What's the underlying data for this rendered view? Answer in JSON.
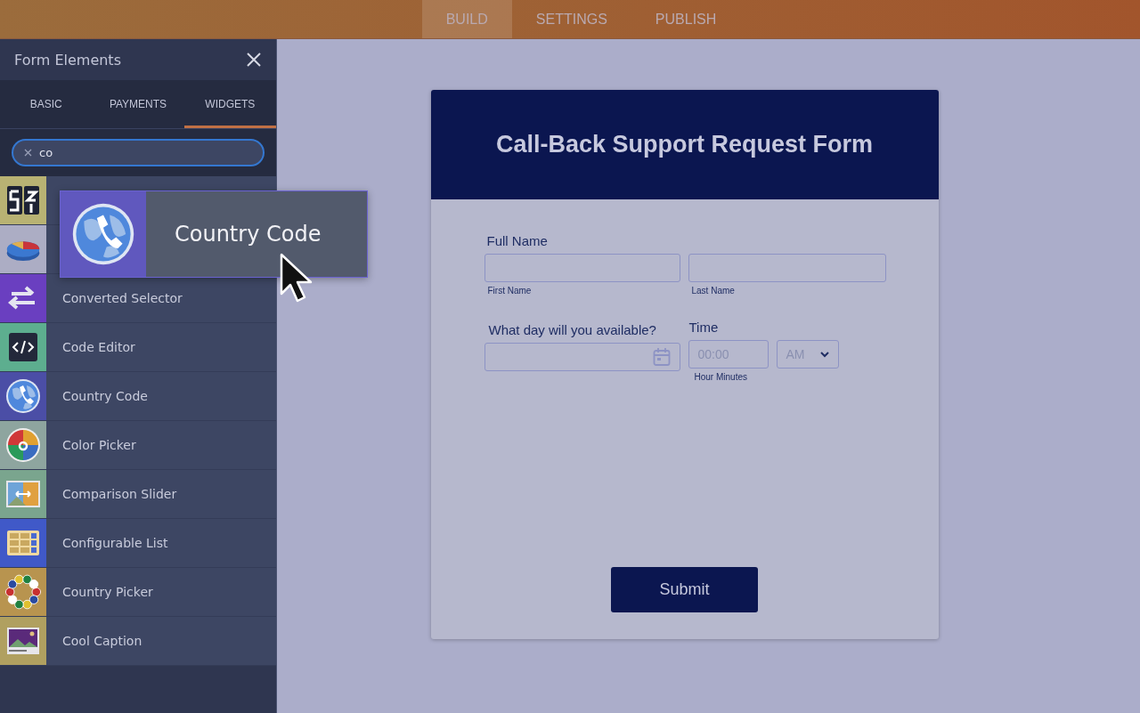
{
  "top_nav": [
    {
      "label": "BUILD",
      "selected": true
    },
    {
      "label": "SETTINGS",
      "selected": false
    },
    {
      "label": "PUBLISH",
      "selected": false
    }
  ],
  "panel": {
    "title": "Form Elements",
    "tabs": [
      {
        "label": "BASIC",
        "selected": false
      },
      {
        "label": "PAYMENTS",
        "selected": false
      },
      {
        "label": "WIDGETS",
        "selected": true
      }
    ],
    "search": {
      "value": "co"
    },
    "items": [
      {
        "kind": "counter",
        "color": "#b8b273"
      },
      {
        "kind": "pie",
        "color": "#acadc4"
      },
      {
        "kind": "arrows",
        "color": "#6a3fc0",
        "label": "Converted Selector"
      },
      {
        "kind": "code",
        "color": "#5dae8f",
        "label": "Code Editor"
      },
      {
        "kind": "globe",
        "color": "#4b4ea6",
        "label": "Country Code"
      },
      {
        "kind": "wheel",
        "color": "#8ea59f",
        "label": "Color Picker"
      },
      {
        "kind": "compare",
        "color": "#7aa58e",
        "label": "Comparison Slider"
      },
      {
        "kind": "list",
        "color": "#4059c8",
        "label": "Configurable List"
      },
      {
        "kind": "flags",
        "color": "#b8944f",
        "label": "Country Picker"
      },
      {
        "kind": "caption",
        "color": "#b0a060",
        "label": "Cool Caption"
      }
    ]
  },
  "drag_card": {
    "kind": "globe",
    "label": "Country Code"
  },
  "form": {
    "title": "Call-Back Support Request Form",
    "full_name": {
      "label": "Full Name",
      "first_sublabel": "First Name",
      "last_sublabel": "Last Name"
    },
    "date": {
      "label": "What day will you available?"
    },
    "time": {
      "label": "Time",
      "placeholder": "00:00",
      "sublabel": "Hour Minutes",
      "ampm": "AM"
    },
    "submit": "Submit"
  }
}
